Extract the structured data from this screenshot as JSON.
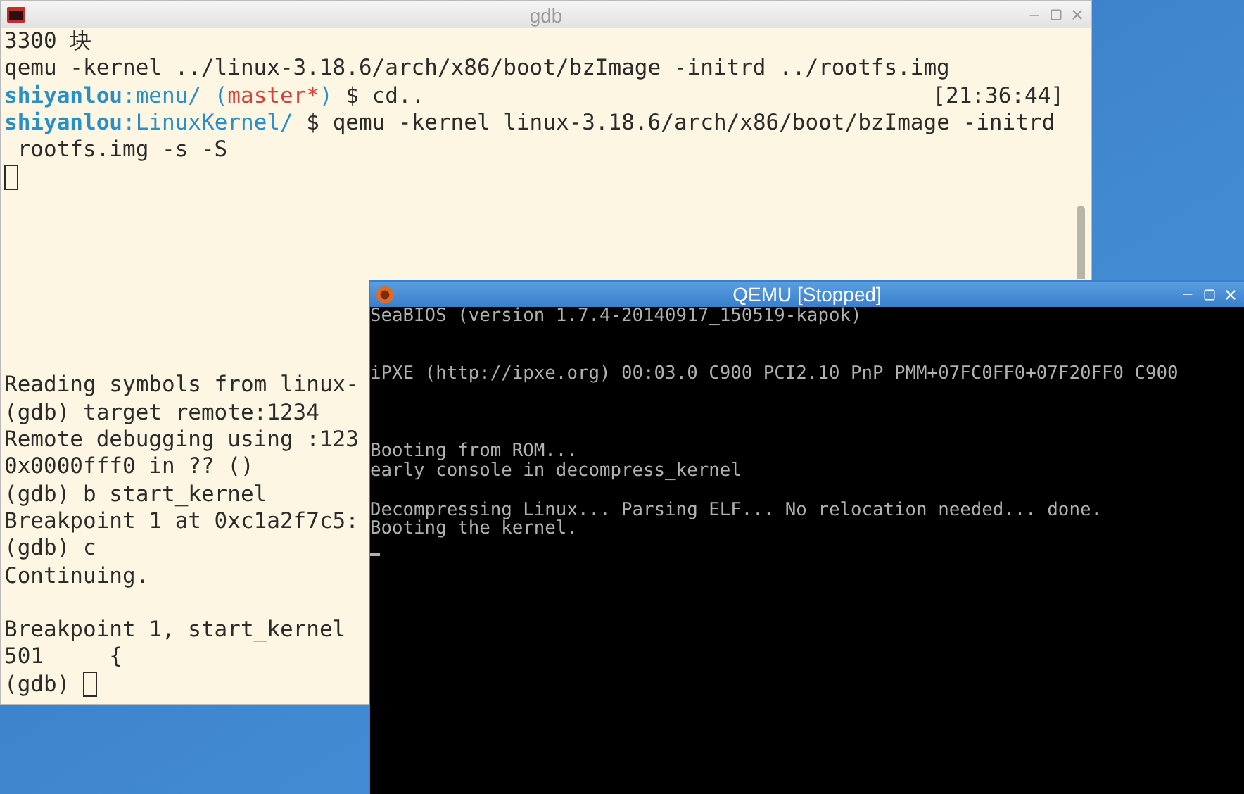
{
  "gdb_window": {
    "title": "gdb",
    "focused": false,
    "shell_lines": [
      {
        "kind": "text",
        "segments": [
          {
            "text": "3300 块",
            "color": "#2b2b2b",
            "bold": false
          }
        ]
      },
      {
        "kind": "text",
        "segments": [
          {
            "text": "qemu -kernel ../linux-3.18.6/arch/x86/boot/bzImage -initrd ../rootfs.img",
            "color": "#2b2b2b",
            "bold": false
          }
        ]
      },
      {
        "kind": "text",
        "segments": [
          {
            "text": "shiyanlou",
            "color": "#2a8fc7",
            "bold": true
          },
          {
            "text": ":menu/ (",
            "color": "#2a8fc7",
            "bold": false
          },
          {
            "text": "master*",
            "color": "#d4423c",
            "bold": false
          },
          {
            "text": ")",
            "color": "#2a8fc7",
            "bold": false
          },
          {
            "text": " $ cd..",
            "color": "#2b2b2b",
            "bold": false
          }
        ],
        "right": "[21:36:44]"
      },
      {
        "kind": "text",
        "segments": [
          {
            "text": "shiyanlou",
            "color": "#2a8fc7",
            "bold": true
          },
          {
            "text": ":LinuxKernel/",
            "color": "#2a8fc7",
            "bold": false
          },
          {
            "text": " $ qemu -kernel linux-3.18.6/arch/x86/boot/bzImage -initrd",
            "color": "#2b2b2b",
            "bold": false
          }
        ]
      },
      {
        "kind": "text",
        "segments": [
          {
            "text": " rootfs.img -s -S",
            "color": "#2b2b2b",
            "bold": false
          }
        ]
      },
      {
        "kind": "cursor"
      }
    ],
    "gdb_lines": [
      {
        "kind": "text",
        "text": "Reading symbols from linux-"
      },
      {
        "kind": "text",
        "text": "(gdb) target remote:1234"
      },
      {
        "kind": "text",
        "text": "Remote debugging using :123"
      },
      {
        "kind": "text",
        "text": "0x0000fff0 in ?? ()"
      },
      {
        "kind": "text",
        "text": "(gdb) b start_kernel"
      },
      {
        "kind": "text",
        "text": "Breakpoint 1 at 0xc1a2f7c5:"
      },
      {
        "kind": "text",
        "text": "(gdb) c"
      },
      {
        "kind": "text",
        "text": "Continuing."
      },
      {
        "kind": "blank"
      },
      {
        "kind": "text",
        "text": "Breakpoint 1, start_kernel"
      },
      {
        "kind": "text",
        "text": "501\t{"
      },
      {
        "kind": "prompt",
        "text": "(gdb) "
      }
    ]
  },
  "qemu_window": {
    "title": "QEMU [Stopped]",
    "focused": true,
    "lines": [
      {
        "kind": "text",
        "text": "SeaBIOS (version 1.7.4-20140917_150519-kapok)"
      },
      {
        "kind": "blank"
      },
      {
        "kind": "blank"
      },
      {
        "kind": "text",
        "text": "iPXE (http://ipxe.org) 00:03.0 C900 PCI2.10 PnP PMM+07FC0FF0+07F20FF0 C900"
      },
      {
        "kind": "blank"
      },
      {
        "kind": "blank"
      },
      {
        "kind": "blank"
      },
      {
        "kind": "text",
        "text": "Booting from ROM..."
      },
      {
        "kind": "text",
        "text": "early console in decompress_kernel"
      },
      {
        "kind": "blank"
      },
      {
        "kind": "text",
        "text": "Decompressing Linux... Parsing ELF... No relocation needed... done."
      },
      {
        "kind": "text",
        "text": "Booting the kernel."
      },
      {
        "kind": "cursor"
      }
    ]
  }
}
